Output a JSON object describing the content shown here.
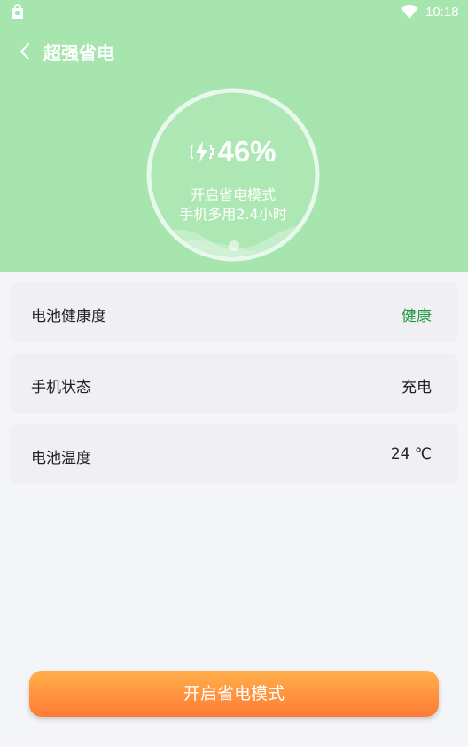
{
  "status_bar": {
    "time": "10:18",
    "app_icon": "shopping-bag-icon",
    "wifi_icon": "wifi-icon"
  },
  "titlebar": {
    "back_icon": "chevron-left-icon",
    "title": "超强省电"
  },
  "battery": {
    "percent": "46%",
    "charge_icon": "battery-charging-icon",
    "mode_line": "开启省电模式",
    "extra_time": "手机多用2.4小时"
  },
  "cards": [
    {
      "label": "电池健康度",
      "value": "健康",
      "value_color": "#1f9a43"
    },
    {
      "label": "手机状态",
      "value": "充电"
    },
    {
      "label": "电池温度",
      "value": "24 ℃"
    }
  ],
  "action": {
    "label": "开启省电模式"
  },
  "colors": {
    "header": "#a6e5ae",
    "accent_green": "#1f9a43",
    "button_top": "#ffb04a",
    "button_bottom": "#ff7a36",
    "background": "#f4f5f9"
  }
}
